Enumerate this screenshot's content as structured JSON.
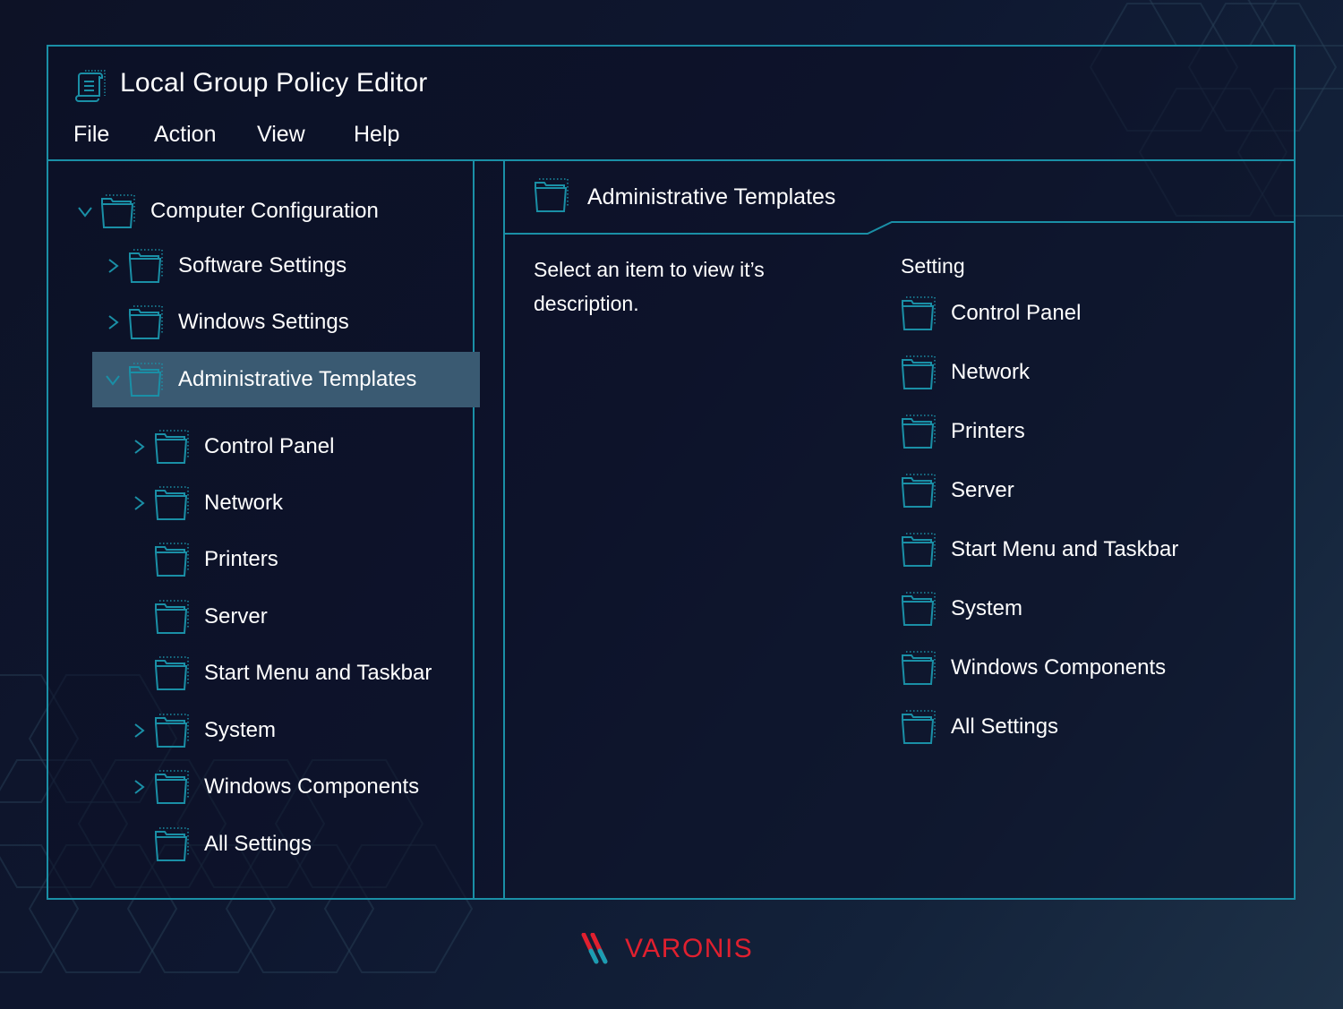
{
  "window": {
    "title": "Local Group Policy Editor",
    "app_icon": "policy-scroll-icon"
  },
  "menu": [
    {
      "label": "File"
    },
    {
      "label": "Action"
    },
    {
      "label": "View"
    },
    {
      "label": "Help"
    }
  ],
  "tree": [
    {
      "label": "Computer Configuration",
      "level": 0,
      "expander": "expanded",
      "selected": false
    },
    {
      "label": "Software Settings",
      "level": 1,
      "expander": "collapsed",
      "selected": false
    },
    {
      "label": "Windows Settings",
      "level": 1,
      "expander": "collapsed",
      "selected": false
    },
    {
      "label": "Administrative Templates",
      "level": 1,
      "expander": "expanded",
      "selected": true
    },
    {
      "label": "Control Panel",
      "level": 2,
      "expander": "collapsed",
      "selected": false
    },
    {
      "label": "Network",
      "level": 2,
      "expander": "collapsed",
      "selected": false
    },
    {
      "label": "Printers",
      "level": 2,
      "expander": "none",
      "selected": false
    },
    {
      "label": "Server",
      "level": 2,
      "expander": "none",
      "selected": false
    },
    {
      "label": "Start Menu and Taskbar",
      "level": 2,
      "expander": "none",
      "selected": false
    },
    {
      "label": "System",
      "level": 2,
      "expander": "collapsed",
      "selected": false
    },
    {
      "label": "Windows Components",
      "level": 2,
      "expander": "collapsed",
      "selected": false
    },
    {
      "label": "All Settings",
      "level": 2,
      "expander": "none",
      "selected": false
    }
  ],
  "details": {
    "header_title": "Administrative Templates",
    "description": "Select an item to view it’s description.",
    "column_header": "Setting",
    "settings": [
      {
        "label": "Control Panel"
      },
      {
        "label": "Network"
      },
      {
        "label": "Printers"
      },
      {
        "label": "Server"
      },
      {
        "label": "Start Menu and Taskbar"
      },
      {
        "label": "System"
      },
      {
        "label": "Windows Components"
      },
      {
        "label": "All Settings"
      }
    ]
  },
  "branding": {
    "logo_text": "VARONIS"
  },
  "colors": {
    "accent": "#1a8fa6",
    "selected_row": "#3a5a72",
    "brand_red": "#e0202f",
    "brand_teal": "#1b9db3",
    "background": "#0d1226"
  }
}
